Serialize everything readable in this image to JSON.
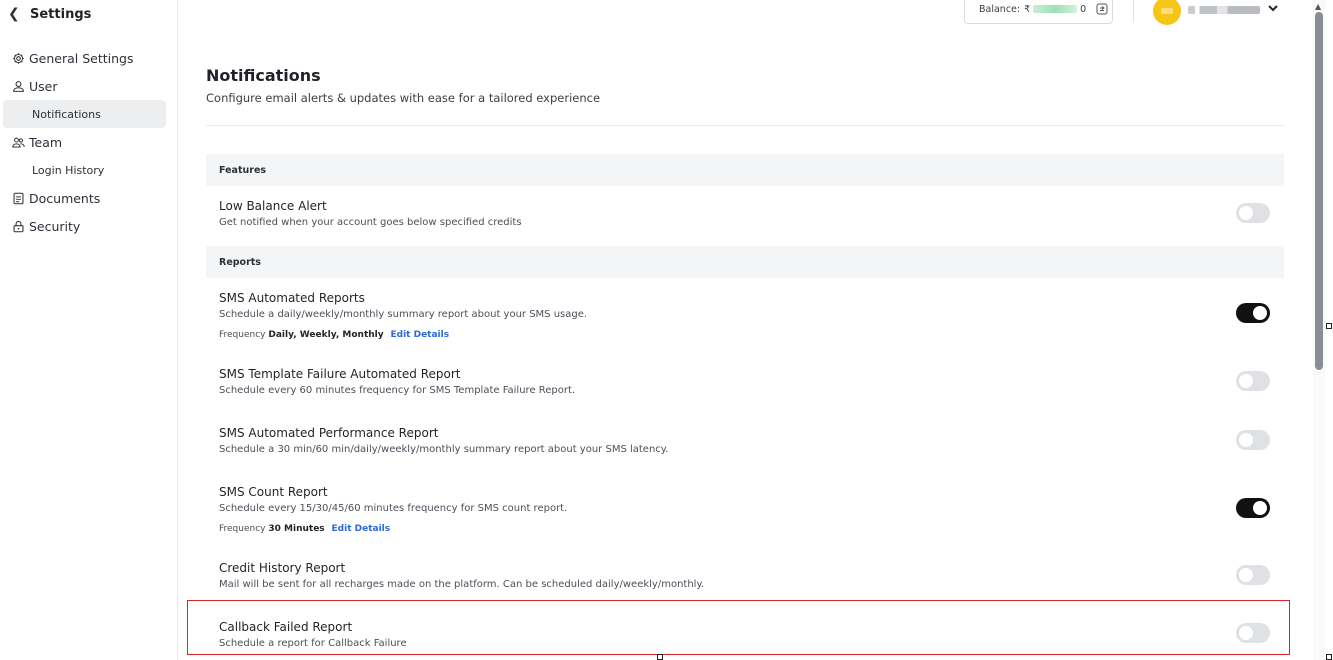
{
  "sidebar": {
    "back_icon": "chevron-left-icon",
    "title": "Settings",
    "items": [
      {
        "label": "General Settings",
        "icon": "gear-icon"
      },
      {
        "label": "User",
        "icon": "user-icon"
      },
      {
        "label": "Notifications",
        "sub": true,
        "active": true
      },
      {
        "label": "Team",
        "icon": "team-icon"
      },
      {
        "label": "Login History",
        "sub": true
      },
      {
        "label": "Documents",
        "icon": "document-icon"
      },
      {
        "label": "Security",
        "icon": "lock-icon"
      }
    ]
  },
  "topbar": {
    "balance_label": "Balance:",
    "balance_symbol": "₹",
    "balance_tail": "0",
    "user_menu_icon": "chevron-down-icon"
  },
  "page": {
    "title": "Notifications",
    "subtitle": "Configure email alerts & updates with ease for a tailored experience"
  },
  "sections": {
    "features": "Features",
    "reports": "Reports"
  },
  "rows": {
    "low_balance": {
      "title": "Low Balance Alert",
      "desc": "Get notified when your account goes below specified credits",
      "enabled": false
    },
    "sms_automated": {
      "title": "SMS Automated Reports",
      "desc": "Schedule a daily/weekly/monthly summary report about your SMS usage.",
      "freq_label": "Frequency",
      "freq_value": "Daily, Weekly, Monthly",
      "edit": "Edit Details",
      "enabled": true
    },
    "sms_template_failure": {
      "title": "SMS Template Failure Automated Report",
      "desc": "Schedule every 60 minutes frequency for SMS Template Failure Report.",
      "enabled": false
    },
    "sms_performance": {
      "title": "SMS Automated Performance Report",
      "desc": "Schedule a 30 min/60 min/daily/weekly/monthly summary report about your SMS latency.",
      "enabled": false
    },
    "sms_count": {
      "title": "SMS Count Report",
      "desc": "Schedule every 15/30/45/60 minutes frequency for SMS count report.",
      "freq_label": "Frequency",
      "freq_value": "30 Minutes",
      "edit": "Edit Details",
      "enabled": true
    },
    "credit_history": {
      "title": "Credit History Report",
      "desc": "Mail will be sent for all recharges made on the platform. Can be scheduled daily/weekly/monthly.",
      "enabled": false
    },
    "callback_failed": {
      "title": "Callback Failed Report",
      "desc": "Schedule a report for Callback Failure",
      "enabled": false
    }
  },
  "colors": {
    "accent_link": "#2b6ad8",
    "toggle_on": "#111111",
    "toggle_off": "#dfe1e4",
    "highlight_border": "#d9262c",
    "avatar": "#f5c518"
  }
}
